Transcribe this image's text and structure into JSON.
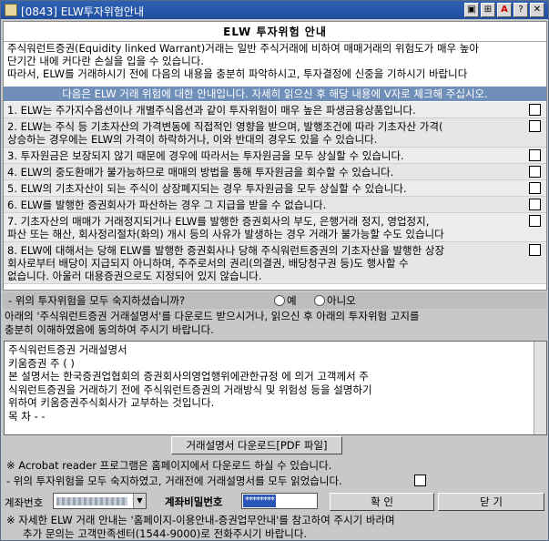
{
  "window": {
    "title": "[0843] ELW투자위험안내",
    "buttons": [
      "▣",
      "⊞",
      "A",
      "?",
      "✕"
    ]
  },
  "notice": {
    "heading": "ELW 투자위험 안내",
    "intro_lines": [
      "주식워런트증권(Equidity linked Warrant)거래는 일반 주식거래에 비하여 매매거래의 위험도가 매우 높아",
      "단기간 내에 커다란 손실을 입을 수 있습니다.",
      "따라서, ELW를 거래하시기 전에 다음의 내용을 충분히 파악하시고, 투자결정에 신중을 기하시기 바랍니다"
    ],
    "banner": "다음은 ELW 거래 위험에 대한 안내입니다. 자세히 읽으신 후 해당 내용에 V자로 체크해 주십시오.",
    "items": [
      [
        "1. ELW는 주가지수옵션이나 개별주식옵션과 같이 투자위험이 매우 높은 파생금융상품입니다."
      ],
      [
        "2. ELW는 주식 등 기초자산의 가격변동에 직접적인 영향을 받으며, 발행조건에 따라 기초자산 가격(",
        "   상승하는 경우에는 ELW의 가격이 하락하거나, 이와 반대의 경우도 있을 수 있습니다."
      ],
      [
        "3. 투자원금은 보장되지 않기 때문에 경우에 따라서는 투자원금을 모두 상실할 수 있습니다."
      ],
      [
        "4. ELW의 중도환매가 불가능하므로 매매의 방법을 통해 투자원금을 회수할 수 있습니다."
      ],
      [
        "5. ELW의 기초자산이 되는 주식이 상장폐지되는 경우 투자원금을 모두 상실할 수 있습니다."
      ],
      [
        "6. ELW를 발행한 증권회사가 파산하는 경우 그 지급을 받을 수 없습니다."
      ],
      [
        "7. 기초자산의 매매가 거래정지되거나 ELW를 발행한 증권회사의 부도, 은행거래 정지, 영업정지,",
        "   파산 또는 해산, 회사정리절차(화의) 개시 등의 사유가 발생하는 경우 거래가 불가능할 수도 있습니다"
      ],
      [
        "8. ELW에 대해서는 당해 ELW를 발행한 증권회사나 당해 주식워런트증권의 기초자산을 발행한 상장",
        "   회사로부터 배당이 지급되지 아니하며, 주주로서의 권리(의결권, 배당청구권 등)도 행사할 수",
        "   없습니다. 아울러 대용증권으로도 지정되어 있지 않습니다."
      ]
    ]
  },
  "question": {
    "label": "- 위의 투자위험을 모두 숙지하셨습니까?",
    "yes": "예",
    "no": "아니오"
  },
  "download_note": [
    "아래의 '주식워런트증권 거래설명서'를 다운로드 받으시거나, 읽으신 후 아래의 투자위험 고지를",
    "충분히 이해하였음에 동의하여 주시기 바랍니다."
  ],
  "document": [
    "주식워런트증권 거래설명서",
    "키움증권 주 ( )",
    "본 설명서는 한국증권업협회의 증권회사의영업행위에관한규정 에 의거 고객께서 주",
    "식워런트증권을 거래하기 전에 주식워런트증권의 거래방식 및 위험성 등을 설명하기",
    "위하여 키움증권주식회사가 교부하는 것입니다.",
    "목 차 - -"
  ],
  "download_button": "거래설명서 다운로드[PDF 파일]",
  "acrobat_note": "※ Acrobat reader 프로그램은 홈페이지에서 다운로드 하실 수 있습니다.",
  "confirm_note": "- 위의 투자위험을 모두 숙지하였고, 거래전에 거래설명서를 모두 읽었습니다.",
  "account": {
    "label": "계좌번호",
    "pw_label": "계좌비밀번호",
    "pw_value": "********"
  },
  "ok_button": "확 인",
  "close_button": "닫 기",
  "footer": [
    "※ 자세한 ELW 거래 안내는 '홈페이지-이용안내-증권업무안내'를 참고하여 주시기 바라며",
    "추가 문의는 고객만족센터(1544-9000)로 전화주시기 바랍니다."
  ]
}
